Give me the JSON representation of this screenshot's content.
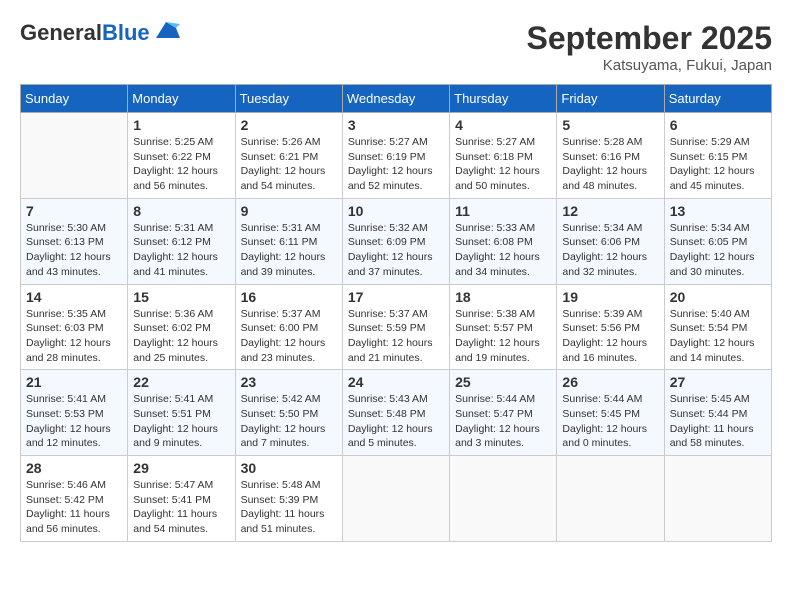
{
  "header": {
    "logo_general": "General",
    "logo_blue": "Blue",
    "month": "September 2025",
    "location": "Katsuyama, Fukui, Japan"
  },
  "days_of_week": [
    "Sunday",
    "Monday",
    "Tuesday",
    "Wednesday",
    "Thursday",
    "Friday",
    "Saturday"
  ],
  "weeks": [
    [
      {
        "day": "",
        "content": ""
      },
      {
        "day": "1",
        "content": "Sunrise: 5:25 AM\nSunset: 6:22 PM\nDaylight: 12 hours\nand 56 minutes."
      },
      {
        "day": "2",
        "content": "Sunrise: 5:26 AM\nSunset: 6:21 PM\nDaylight: 12 hours\nand 54 minutes."
      },
      {
        "day": "3",
        "content": "Sunrise: 5:27 AM\nSunset: 6:19 PM\nDaylight: 12 hours\nand 52 minutes."
      },
      {
        "day": "4",
        "content": "Sunrise: 5:27 AM\nSunset: 6:18 PM\nDaylight: 12 hours\nand 50 minutes."
      },
      {
        "day": "5",
        "content": "Sunrise: 5:28 AM\nSunset: 6:16 PM\nDaylight: 12 hours\nand 48 minutes."
      },
      {
        "day": "6",
        "content": "Sunrise: 5:29 AM\nSunset: 6:15 PM\nDaylight: 12 hours\nand 45 minutes."
      }
    ],
    [
      {
        "day": "7",
        "content": "Sunrise: 5:30 AM\nSunset: 6:13 PM\nDaylight: 12 hours\nand 43 minutes."
      },
      {
        "day": "8",
        "content": "Sunrise: 5:31 AM\nSunset: 6:12 PM\nDaylight: 12 hours\nand 41 minutes."
      },
      {
        "day": "9",
        "content": "Sunrise: 5:31 AM\nSunset: 6:11 PM\nDaylight: 12 hours\nand 39 minutes."
      },
      {
        "day": "10",
        "content": "Sunrise: 5:32 AM\nSunset: 6:09 PM\nDaylight: 12 hours\nand 37 minutes."
      },
      {
        "day": "11",
        "content": "Sunrise: 5:33 AM\nSunset: 6:08 PM\nDaylight: 12 hours\nand 34 minutes."
      },
      {
        "day": "12",
        "content": "Sunrise: 5:34 AM\nSunset: 6:06 PM\nDaylight: 12 hours\nand 32 minutes."
      },
      {
        "day": "13",
        "content": "Sunrise: 5:34 AM\nSunset: 6:05 PM\nDaylight: 12 hours\nand 30 minutes."
      }
    ],
    [
      {
        "day": "14",
        "content": "Sunrise: 5:35 AM\nSunset: 6:03 PM\nDaylight: 12 hours\nand 28 minutes."
      },
      {
        "day": "15",
        "content": "Sunrise: 5:36 AM\nSunset: 6:02 PM\nDaylight: 12 hours\nand 25 minutes."
      },
      {
        "day": "16",
        "content": "Sunrise: 5:37 AM\nSunset: 6:00 PM\nDaylight: 12 hours\nand 23 minutes."
      },
      {
        "day": "17",
        "content": "Sunrise: 5:37 AM\nSunset: 5:59 PM\nDaylight: 12 hours\nand 21 minutes."
      },
      {
        "day": "18",
        "content": "Sunrise: 5:38 AM\nSunset: 5:57 PM\nDaylight: 12 hours\nand 19 minutes."
      },
      {
        "day": "19",
        "content": "Sunrise: 5:39 AM\nSunset: 5:56 PM\nDaylight: 12 hours\nand 16 minutes."
      },
      {
        "day": "20",
        "content": "Sunrise: 5:40 AM\nSunset: 5:54 PM\nDaylight: 12 hours\nand 14 minutes."
      }
    ],
    [
      {
        "day": "21",
        "content": "Sunrise: 5:41 AM\nSunset: 5:53 PM\nDaylight: 12 hours\nand 12 minutes."
      },
      {
        "day": "22",
        "content": "Sunrise: 5:41 AM\nSunset: 5:51 PM\nDaylight: 12 hours\nand 9 minutes."
      },
      {
        "day": "23",
        "content": "Sunrise: 5:42 AM\nSunset: 5:50 PM\nDaylight: 12 hours\nand 7 minutes."
      },
      {
        "day": "24",
        "content": "Sunrise: 5:43 AM\nSunset: 5:48 PM\nDaylight: 12 hours\nand 5 minutes."
      },
      {
        "day": "25",
        "content": "Sunrise: 5:44 AM\nSunset: 5:47 PM\nDaylight: 12 hours\nand 3 minutes."
      },
      {
        "day": "26",
        "content": "Sunrise: 5:44 AM\nSunset: 5:45 PM\nDaylight: 12 hours\nand 0 minutes."
      },
      {
        "day": "27",
        "content": "Sunrise: 5:45 AM\nSunset: 5:44 PM\nDaylight: 11 hours\nand 58 minutes."
      }
    ],
    [
      {
        "day": "28",
        "content": "Sunrise: 5:46 AM\nSunset: 5:42 PM\nDaylight: 11 hours\nand 56 minutes."
      },
      {
        "day": "29",
        "content": "Sunrise: 5:47 AM\nSunset: 5:41 PM\nDaylight: 11 hours\nand 54 minutes."
      },
      {
        "day": "30",
        "content": "Sunrise: 5:48 AM\nSunset: 5:39 PM\nDaylight: 11 hours\nand 51 minutes."
      },
      {
        "day": "",
        "content": ""
      },
      {
        "day": "",
        "content": ""
      },
      {
        "day": "",
        "content": ""
      },
      {
        "day": "",
        "content": ""
      }
    ]
  ]
}
